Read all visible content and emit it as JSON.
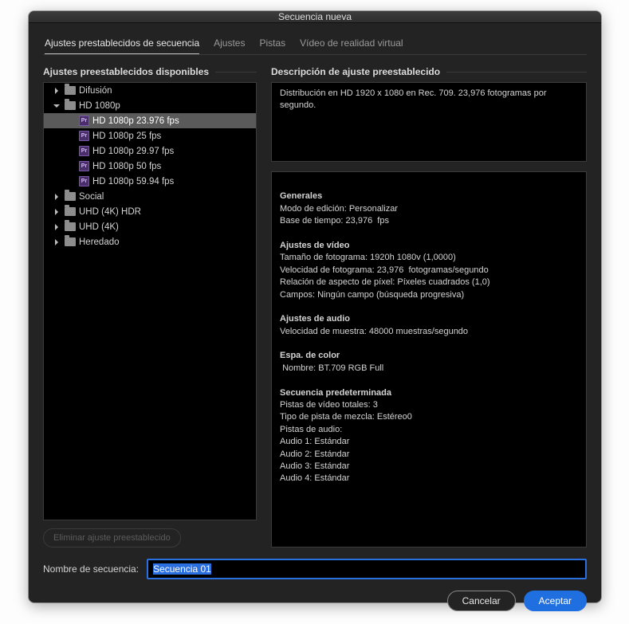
{
  "title": "Secuencia nueva",
  "tabs": {
    "presets": "Ajustes prestablecidos de secuencia",
    "settings": "Ajustes",
    "tracks": "Pistas",
    "vr": "Vídeo de realidad virtual"
  },
  "left": {
    "header": "Ajustes preestablecidos disponibles",
    "tree": [
      {
        "kind": "folder",
        "label": "Difusión",
        "depth": 0,
        "expanded": false
      },
      {
        "kind": "folder",
        "label": "HD 1080p",
        "depth": 0,
        "expanded": true
      },
      {
        "kind": "preset",
        "label": "HD 1080p 23.976 fps",
        "depth": 1,
        "selected": true
      },
      {
        "kind": "preset",
        "label": "HD 1080p 25 fps",
        "depth": 1
      },
      {
        "kind": "preset",
        "label": "HD 1080p 29.97 fps",
        "depth": 1
      },
      {
        "kind": "preset",
        "label": "HD 1080p 50 fps",
        "depth": 1
      },
      {
        "kind": "preset",
        "label": "HD 1080p 59.94 fps",
        "depth": 1
      },
      {
        "kind": "folder",
        "label": "Social",
        "depth": 0,
        "expanded": false
      },
      {
        "kind": "folder",
        "label": "UHD (4K) HDR",
        "depth": 0,
        "expanded": false
      },
      {
        "kind": "folder",
        "label": "UHD (4K)",
        "depth": 0,
        "expanded": false
      },
      {
        "kind": "folder",
        "label": "Heredado",
        "depth": 0,
        "expanded": false
      }
    ],
    "delete_btn": "Eliminar ajuste preestablecido"
  },
  "right": {
    "header": "Descripción de ajuste preestablecido",
    "summary": "Distribución en HD 1920 x 1080 en Rec. 709. 23,976 fotogramas por segundo.",
    "details": {
      "general_hd": "Generales",
      "edit_mode": "Modo de edición: Personalizar",
      "timebase": "Base de tiempo: 23,976  fps",
      "video_hd": "Ajustes de vídeo",
      "frame_size": "Tamaño de fotograma: 1920h 1080v (1,0000)",
      "frame_rate": "Velocidad de fotograma: 23,976  fotogramas/segundo",
      "pixel_aspect": "Relación de aspecto de píxel: Píxeles cuadrados (1,0)",
      "fields": "Campos: Ningún campo (búsqueda progresiva)",
      "audio_hd": "Ajustes de audio",
      "sample_rate": "Velocidad de muestra: 48000 muestras/segundo",
      "color_hd": "Espa. de color",
      "color_name": " Nombre: BT.709 RGB Full",
      "seq_hd": "Secuencia predeterminada",
      "video_tracks": "Pistas de vídeo totales: 3",
      "mix_type": "Tipo de pista de mezcla: Estéreo0",
      "audio_tracks_hd": "Pistas de audio:",
      "a1": "Audio 1: Estándar",
      "a2": "Audio 2: Estándar",
      "a3": "Audio 3: Estándar",
      "a4": "Audio 4: Estándar"
    }
  },
  "name": {
    "label": "Nombre de secuencia:",
    "value": "Secuencia 01"
  },
  "footer": {
    "cancel": "Cancelar",
    "ok": "Aceptar"
  }
}
